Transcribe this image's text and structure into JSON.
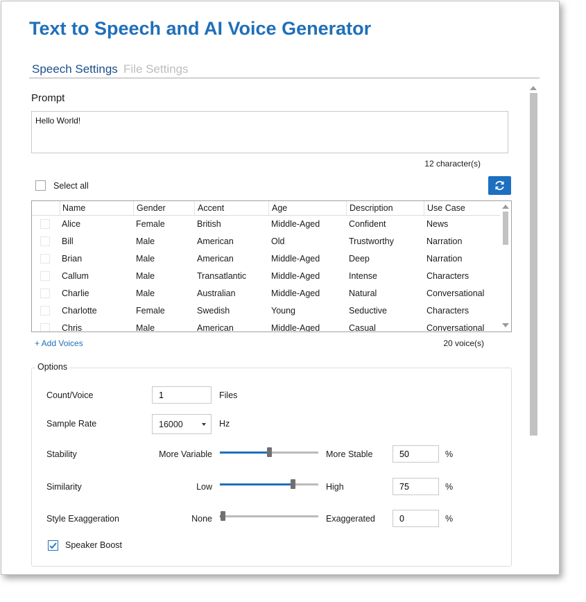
{
  "app": {
    "title": "Text to Speech and AI Voice Generator"
  },
  "tabs": [
    {
      "label": "Speech Settings",
      "active": true
    },
    {
      "label": "File Settings",
      "active": false
    }
  ],
  "prompt": {
    "label": "Prompt",
    "value": "Hello World!",
    "char_count": "12 character(s)"
  },
  "voices": {
    "select_all_label": "Select all",
    "refresh_icon": "refresh-icon",
    "columns": [
      "Name",
      "Gender",
      "Accent",
      "Age",
      "Description",
      "Use Case"
    ],
    "rows": [
      [
        "Alice",
        "Female",
        "British",
        "Middle-Aged",
        "Confident",
        "News"
      ],
      [
        "Bill",
        "Male",
        "American",
        "Old",
        "Trustworthy",
        "Narration"
      ],
      [
        "Brian",
        "Male",
        "American",
        "Middle-Aged",
        "Deep",
        "Narration"
      ],
      [
        "Callum",
        "Male",
        "Transatlantic",
        "Middle-Aged",
        "Intense",
        "Characters"
      ],
      [
        "Charlie",
        "Male",
        "Australian",
        "Middle-Aged",
        "Natural",
        "Conversational"
      ],
      [
        "Charlotte",
        "Female",
        "Swedish",
        "Young",
        "Seductive",
        "Characters"
      ],
      [
        "Chris",
        "Male",
        "American",
        "Middle-Aged",
        "Casual",
        "Conversational"
      ]
    ],
    "add_voices_label": "+ Add Voices",
    "voice_count": "20 voice(s)"
  },
  "options": {
    "legend": "Options",
    "count": {
      "label": "Count/Voice",
      "value": "1",
      "unit": "Files"
    },
    "sample_rate": {
      "label": "Sample Rate",
      "value": "16000",
      "unit": "Hz"
    },
    "stability": {
      "label": "Stability",
      "left": "More Variable",
      "right": "More Stable",
      "value": "50",
      "percent": 50,
      "unit": "%"
    },
    "similarity": {
      "label": "Similarity",
      "left": "Low",
      "right": "High",
      "value": "75",
      "percent": 75,
      "unit": "%"
    },
    "style": {
      "label": "Style Exaggeration",
      "left": "None",
      "right": "Exaggerated",
      "value": "0",
      "percent": 0,
      "unit": "%"
    },
    "speaker_boost": {
      "label": "Speaker Boost",
      "checked": true
    }
  },
  "colors": {
    "accent": "#1d6fc0",
    "title": "#1f6fb8"
  }
}
